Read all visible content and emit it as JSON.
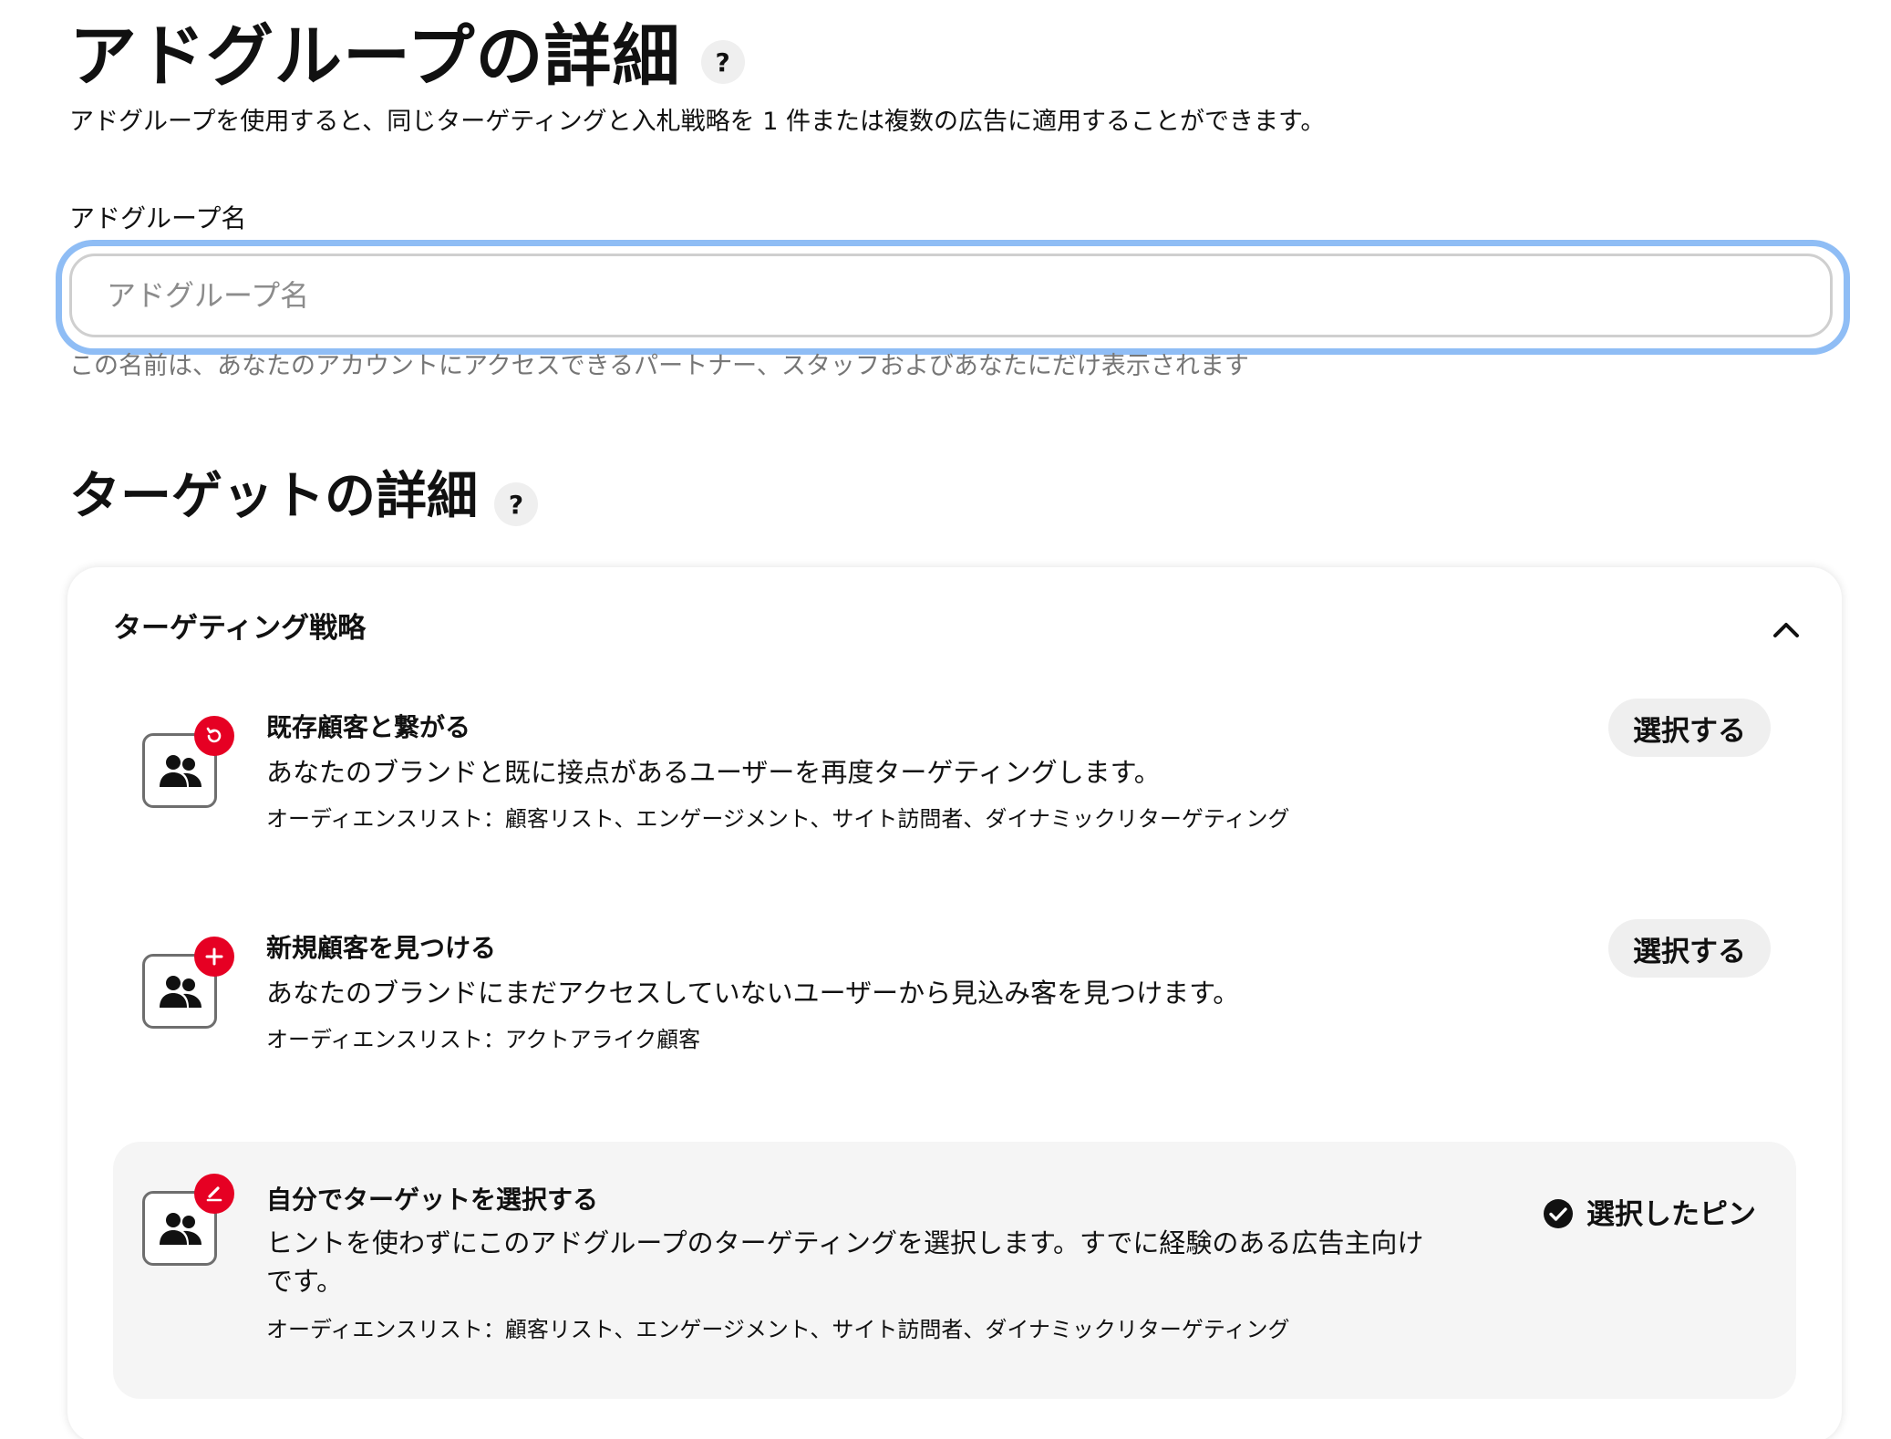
{
  "adgroup": {
    "title": "アドグループの詳細",
    "help": "?",
    "subtitle": "アドグループを使用すると、同じターゲティングと入札戦略を 1 件または複数の広告に適用することができます。",
    "name_label": "アドグループ名",
    "name_placeholder": "アドグループ名",
    "name_value": "",
    "name_helper": "この名前は、あなたのアカウントにアクセスできるパートナー、スタッフおよびあなたにだけ表示されます"
  },
  "target": {
    "title": "ターゲットの詳細",
    "help": "?"
  },
  "strategy": {
    "header": "ターゲティング戦略",
    "options": [
      {
        "title": "既存顧客と繋がる",
        "description": "あなたのブランドと既に接点があるユーザーを再度ターゲティングします。",
        "audience": "オーディエンスリスト：顧客リスト、エンゲージメント、サイト訪問者、ダイナミックリターゲティング",
        "button": "選択する",
        "badge_icon": "refresh-icon"
      },
      {
        "title": "新規顧客を見つける",
        "description": "あなたのブランドにまだアクセスしていないユーザーから見込み客を見つけます。",
        "audience": "オーディエンスリスト：アクトアライク顧客",
        "button": "選択する",
        "badge_icon": "plus-icon"
      },
      {
        "title": "自分でターゲットを選択する",
        "description": "ヒントを使わずにこのアドグループのターゲティングを選択します。すでに経験のある広告主向けです。",
        "audience": "オーディエンスリスト：顧客リスト、エンゲージメント、サイト訪問者、ダイナミックリターゲティング",
        "selected_label": "選択したピン",
        "badge_icon": "pencil-icon"
      }
    ]
  },
  "colors": {
    "accent_red": "#e60023",
    "focus_ring": "#8fbdf5",
    "muted_text": "#767676"
  }
}
